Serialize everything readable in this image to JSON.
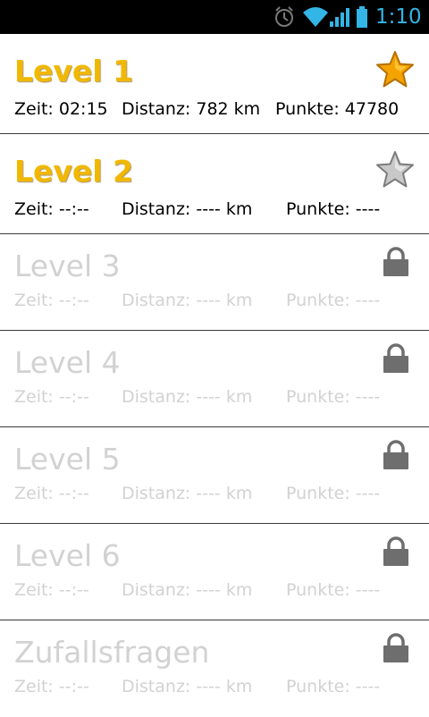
{
  "status_bar": {
    "time": "1:10",
    "icons": [
      "alarm-icon",
      "wifi-icon",
      "signal-icon",
      "battery-icon"
    ],
    "time_color": "#33b5e5"
  },
  "colors": {
    "unlocked_title": "#f1b800",
    "locked_text": "#d2d2d2",
    "divider": "#3a3a3a",
    "lock_icon": "#6e6e6e",
    "gold_star": "#f4a300",
    "silver_star": "#c8c8c8"
  },
  "levels": [
    {
      "title": "Level 1",
      "time": "Zeit: 02:15",
      "distance": "Distanz: 782 km",
      "points": "Punkte: 47780",
      "status_icon": "gold-star-icon"
    },
    {
      "title": "Level 2",
      "time": "Zeit: --:--",
      "distance": "Distanz: ---- km",
      "points": "Punkte: ----",
      "status_icon": "silver-star-icon"
    },
    {
      "title": "Level 3",
      "time": "Zeit: --:--",
      "distance": "Distanz: ---- km",
      "points": "Punkte: ----",
      "status_icon": "lock-icon"
    },
    {
      "title": "Level 4",
      "time": "Zeit: --:--",
      "distance": "Distanz: ---- km",
      "points": "Punkte: ----",
      "status_icon": "lock-icon"
    },
    {
      "title": "Level 5",
      "time": "Zeit: --:--",
      "distance": "Distanz: ---- km",
      "points": "Punkte: ----",
      "status_icon": "lock-icon"
    },
    {
      "title": "Level 6",
      "time": "Zeit: --:--",
      "distance": "Distanz: ---- km",
      "points": "Punkte: ----",
      "status_icon": "lock-icon"
    },
    {
      "title": "Zufallsfragen",
      "time": "Zeit: --:--",
      "distance": "Distanz: ---- km",
      "points": "Punkte: ----",
      "status_icon": "lock-icon"
    }
  ]
}
